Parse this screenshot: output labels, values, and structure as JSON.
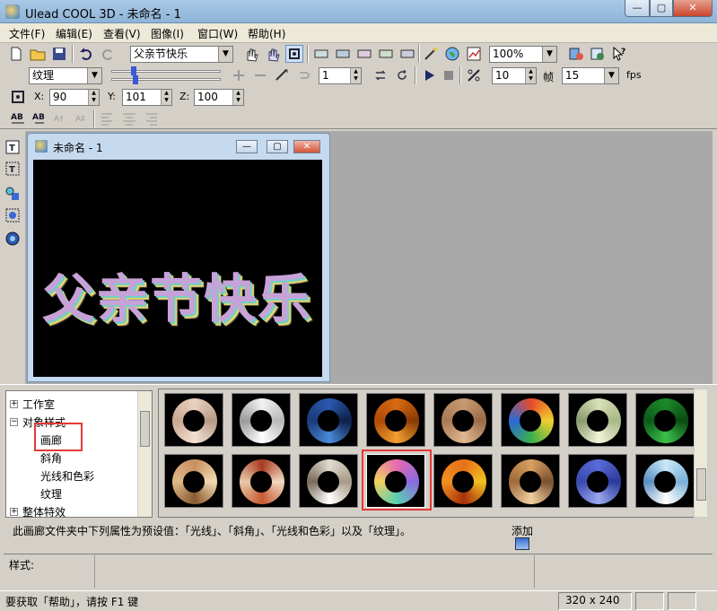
{
  "window": {
    "title": "Ulead COOL 3D - 未命名 - 1",
    "min_label": "—",
    "max_label": "▢",
    "close_label": "✕"
  },
  "menu": [
    "文件(F)",
    "编辑(E)",
    "查看(V)",
    "图像(I)",
    "窗口(W)",
    "帮助(H)"
  ],
  "toolbar1": {
    "text_combo": "父亲节快乐",
    "zoom_combo": "100%"
  },
  "toolbar2": {
    "texture_combo": "纹理",
    "frame_value": "1",
    "frames_value": "10",
    "frame_label": "帧",
    "fps_value": "15",
    "fps_label": "fps"
  },
  "toolbar3": {
    "x_label": "X:",
    "x_value": "90",
    "y_label": "Y:",
    "y_value": "101",
    "z_label": "Z:",
    "z_value": "100"
  },
  "document": {
    "title": "未命名 - 1",
    "canvas_text": "父亲节快乐"
  },
  "tree": {
    "items": [
      "工作室",
      "对象样式",
      "画廊",
      "斜角",
      "光线和色彩",
      "纹理",
      "整体特效"
    ]
  },
  "gallery": {
    "description": "此画廊文件夹中下列属性为预设值：「光线」、「斜角」、「光线和色彩」以及「纹理」。",
    "add_label": "添加",
    "selected_index": 11
  },
  "style_label": "样式:",
  "status": {
    "help_text": "要获取「帮助」，请按 F1 键",
    "dimensions": "320 x 240"
  },
  "colors": {
    "highlight": "#e53935"
  }
}
